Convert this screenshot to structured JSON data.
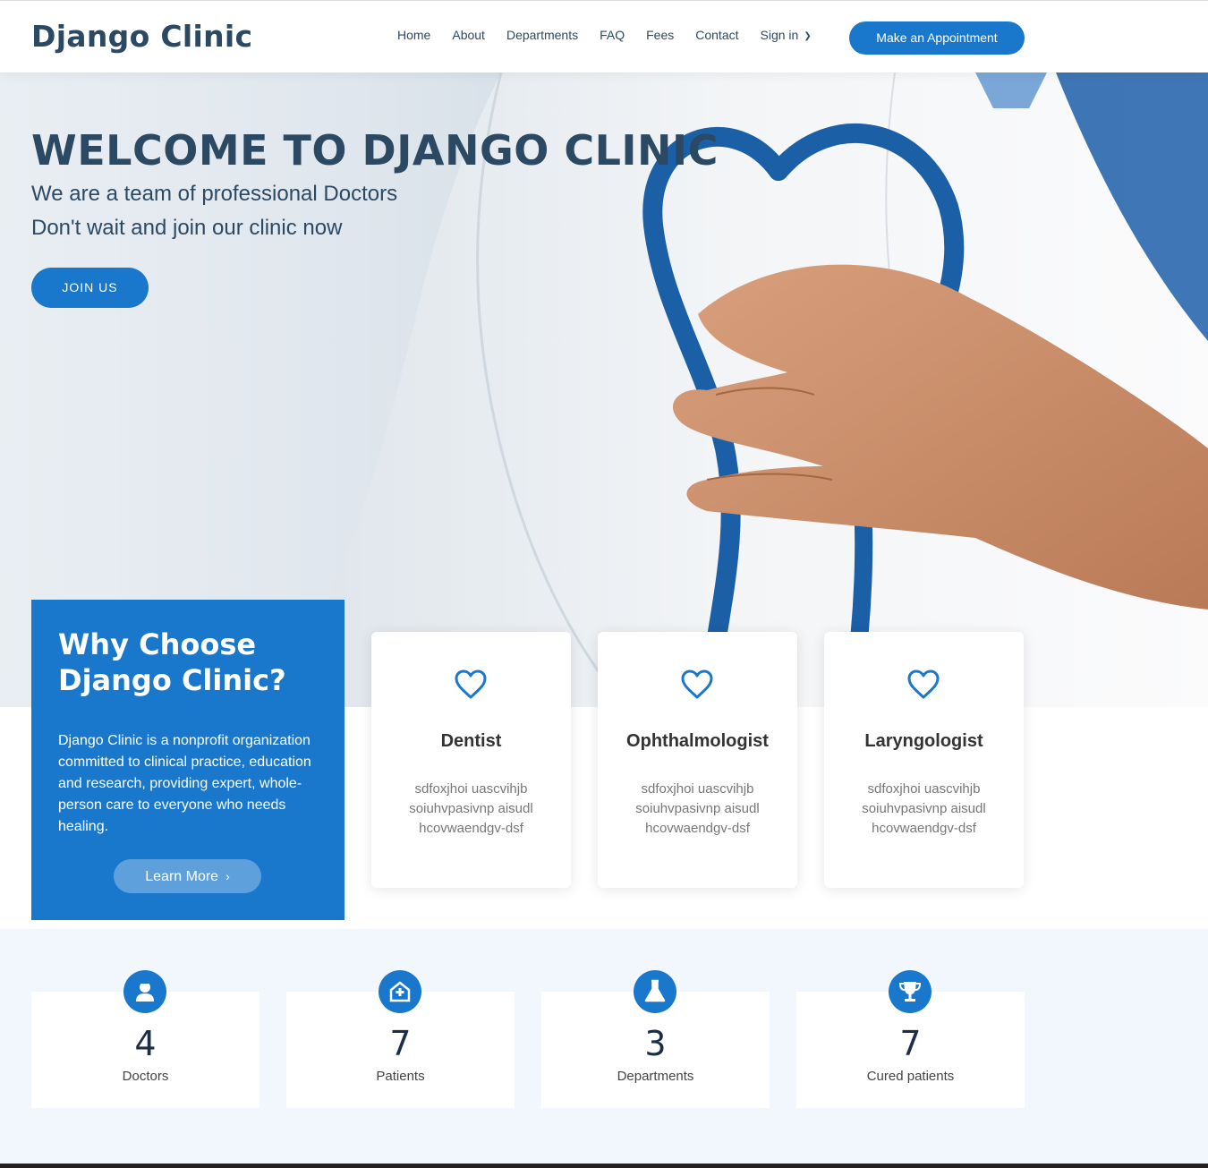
{
  "header": {
    "logo": "Django Clinic",
    "nav": [
      "Home",
      "About",
      "Departments",
      "FAQ",
      "Fees",
      "Contact",
      "Sign in"
    ],
    "appointment_button": "Make an Appointment"
  },
  "hero": {
    "title": "WELCOME TO DJANGO CLINIC",
    "subtitle_line1": "We are a team of professional Doctors",
    "subtitle_line2": "Don't wait and join our clinic now",
    "join_button": "JOIN US"
  },
  "why": {
    "title": "Why Choose Django Clinic?",
    "text": "Django Clinic is a nonprofit organization committed to clinical practice, education and research, providing expert, whole-person care to everyone who needs healing.",
    "learn_more": "Learn More"
  },
  "departments": [
    {
      "name": "Dentist",
      "description": "sdfoxjhoi uascvihjb soiuhvpasivnp aisudl hcovwaendgv-dsf",
      "icon": "heart-icon"
    },
    {
      "name": "Ophthalmologist",
      "description": "sdfoxjhoi uascvihjb soiuhvpasivnp aisudl hcovwaendgv-dsf",
      "icon": "heart-icon"
    },
    {
      "name": "Laryngologist",
      "description": "sdfoxjhoi uascvihjb soiuhvpasivnp aisudl hcovwaendgv-dsf",
      "icon": "heart-icon"
    }
  ],
  "counts": [
    {
      "value": "4",
      "label": "Doctors",
      "icon": "doctor-icon"
    },
    {
      "value": "7",
      "label": "Patients",
      "icon": "hospital-icon"
    },
    {
      "value": "3",
      "label": "Departments",
      "icon": "flask-icon"
    },
    {
      "value": "7",
      "label": "Cured patients",
      "icon": "trophy-icon"
    }
  ],
  "colors": {
    "accent": "#1977cc",
    "text": "#2c4964",
    "counts_bg": "#f1f7fd"
  }
}
